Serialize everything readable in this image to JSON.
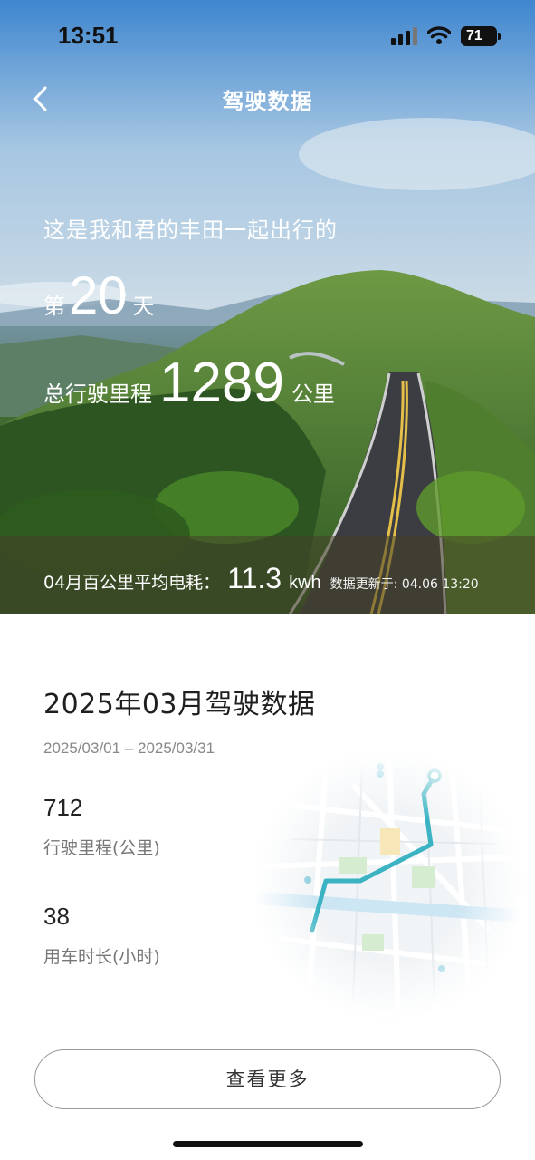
{
  "status_bar": {
    "time": "13:51",
    "battery": "71"
  },
  "nav": {
    "title": "驾驶数据"
  },
  "hero": {
    "intro": "这是我和君的丰田一起出行的",
    "day_prefix": "第",
    "day_count": "20",
    "day_suffix": "天",
    "mileage_prefix": "总行驶里程",
    "mileage_value": "1289",
    "mileage_unit": "公里",
    "energy_label": "04月百公里平均电耗：",
    "energy_value": "11.3",
    "energy_unit": "kwh",
    "update_text": "数据更新于: 04.06 13:20"
  },
  "monthly": {
    "title": "2025年03月驾驶数据",
    "range": "2025/03/01 – 2025/03/31",
    "stats": [
      {
        "value": "712",
        "label": "行驶里程(公里)"
      },
      {
        "value": "38",
        "label": "用车时长(小时)"
      }
    ]
  },
  "more_button": "查看更多",
  "colors": {
    "route": "#3bb3c3",
    "accent_bg": "#ffffff"
  },
  "icons": [
    "back-chevron-icon",
    "signal-icon",
    "wifi-icon",
    "battery-icon",
    "route-map-illustration",
    "map-pin-icon"
  ]
}
